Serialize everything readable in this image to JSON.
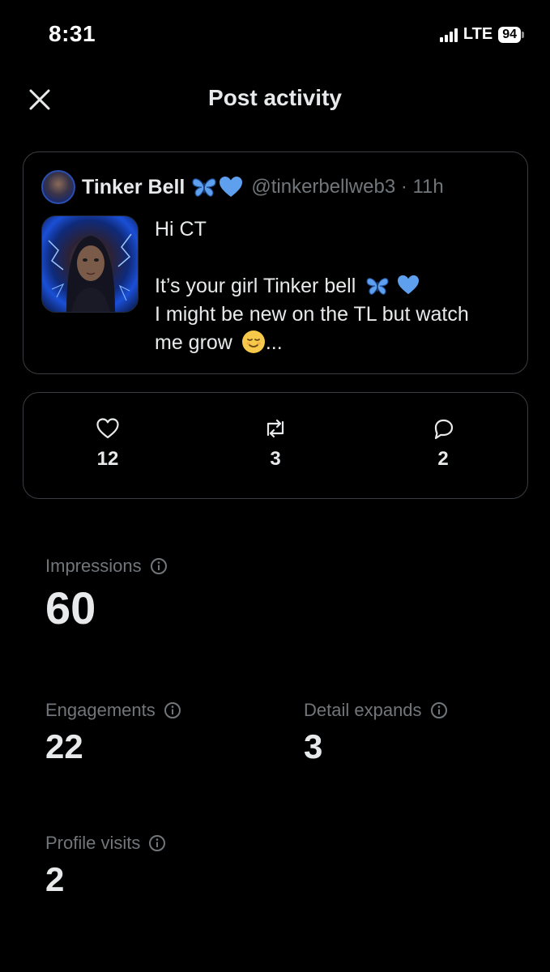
{
  "status_bar": {
    "time": "8:31",
    "network": "LTE",
    "battery": "94"
  },
  "header": {
    "title": "Post activity",
    "close_icon": "close-icon"
  },
  "post": {
    "author_name": "Tinker Bell",
    "author_emojis": [
      "butterfly",
      "blue-heart"
    ],
    "handle_time": "@tinkerbellweb3 · 11h",
    "text_line_1": "Hi CT",
    "text_line_2": "It’s your girl Tinker bell",
    "text_line_3": "I might be new on the TL  but watch",
    "text_line_4a": "me grow",
    "text_line_4b": "..."
  },
  "engagements_bar": {
    "likes": "12",
    "reposts": "3",
    "replies": "2",
    "icons": [
      "heart-icon",
      "repost-icon",
      "reply-icon"
    ]
  },
  "metrics": {
    "impressions": {
      "label": "Impressions",
      "value": "60"
    },
    "engagements": {
      "label": "Engagements",
      "value": "22"
    },
    "detail_expands": {
      "label": "Detail expands",
      "value": "3"
    },
    "profile_visits": {
      "label": "Profile visits",
      "value": "2"
    }
  },
  "colors": {
    "background": "#000000",
    "text_primary": "#e7e9ea",
    "text_secondary": "#71767b",
    "border": "#3a3d41",
    "blue_heart": "#5ea0ee"
  }
}
